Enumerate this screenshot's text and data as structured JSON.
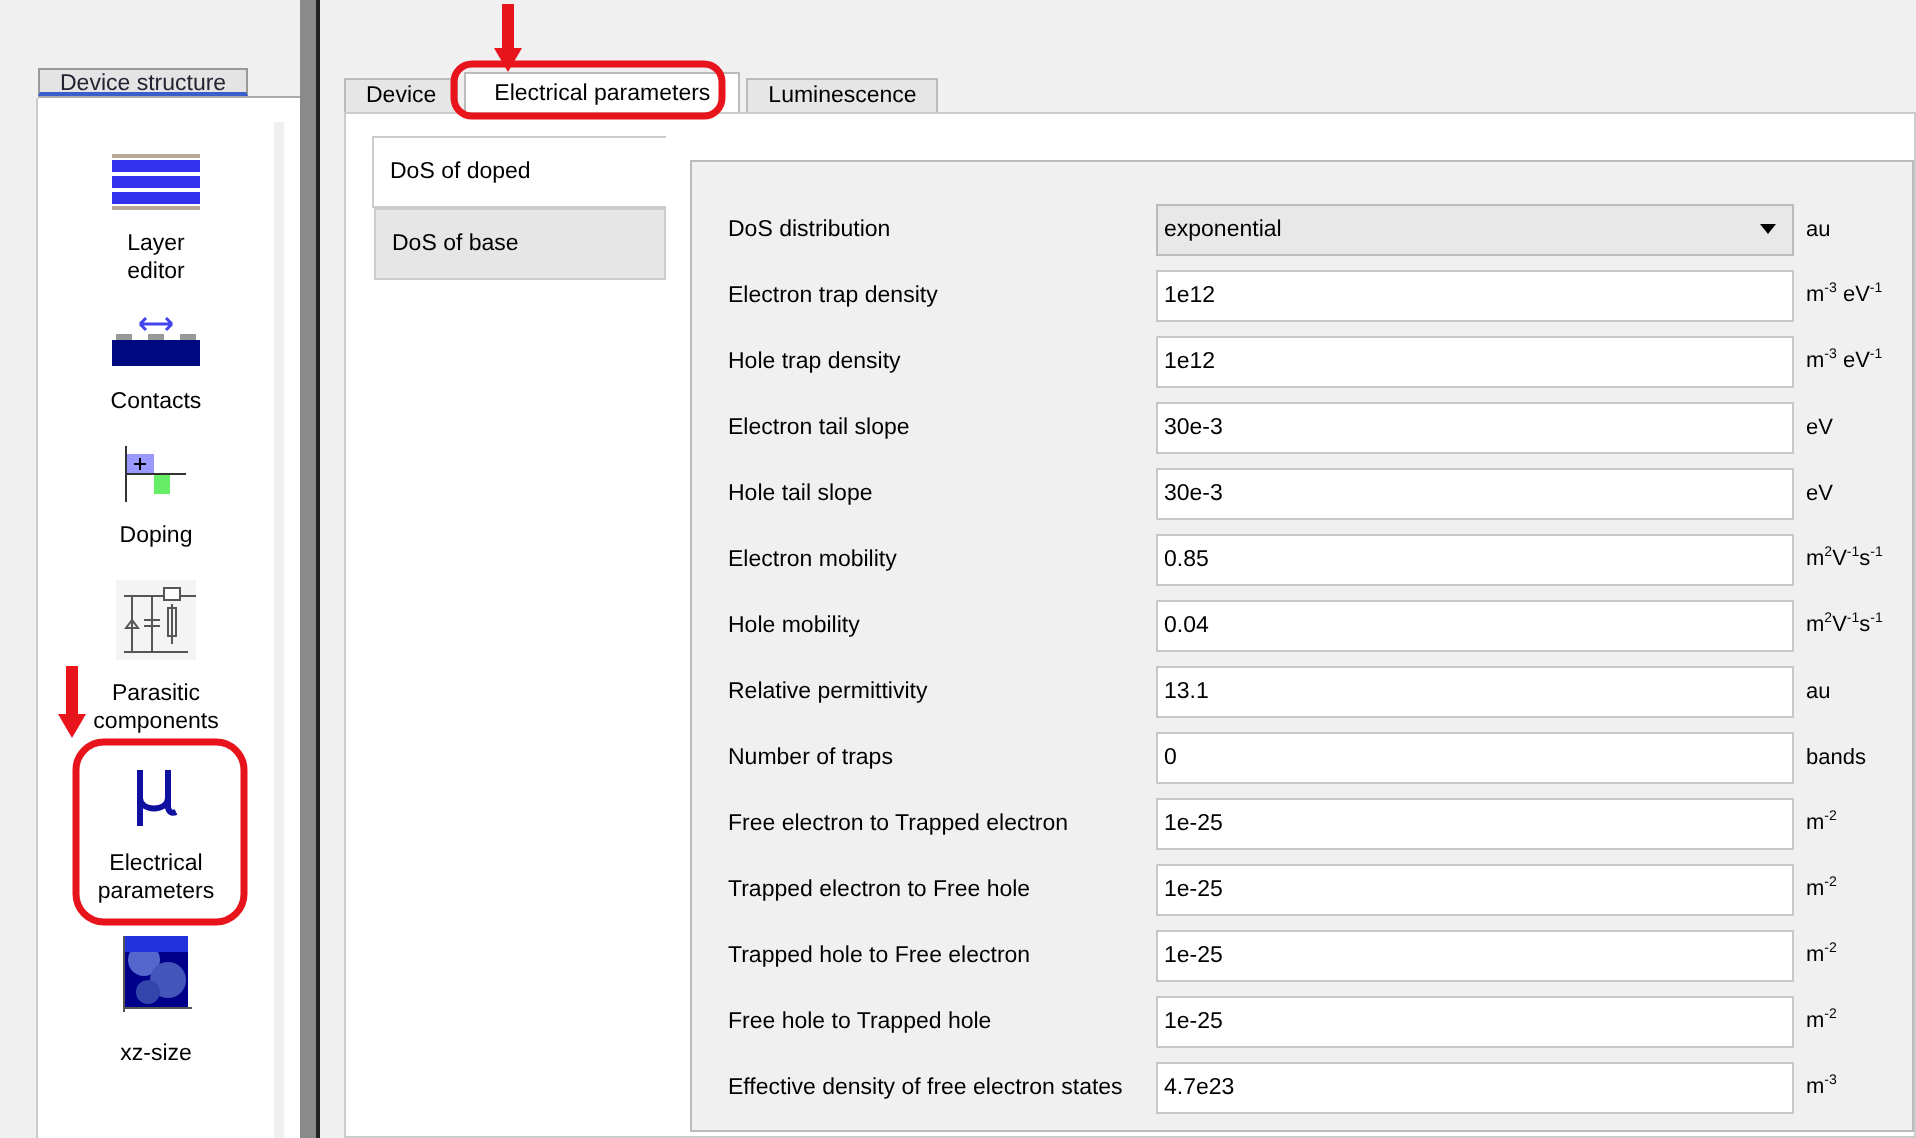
{
  "sidebar": {
    "tab": "Device structure",
    "items": [
      {
        "kind": "layers",
        "label": "Layer\neditor"
      },
      {
        "kind": "contacts",
        "label": "Contacts"
      },
      {
        "kind": "doping",
        "label": "Doping"
      },
      {
        "kind": "circuit",
        "label": "Parasitic\ncomponents"
      },
      {
        "kind": "mu",
        "label": "Electrical\nparameters"
      },
      {
        "kind": "picture",
        "label": "xz-size"
      }
    ]
  },
  "tabs": [
    {
      "label": "Device",
      "selected": false
    },
    {
      "label": "Electrical parameters",
      "selected": true
    },
    {
      "label": "Luminescence",
      "selected": false
    }
  ],
  "side_tabs": [
    {
      "label": "DoS of doped",
      "selected": true
    },
    {
      "label": "DoS of base",
      "selected": false
    }
  ],
  "rows": [
    {
      "kind": "select",
      "label": "DoS distribution",
      "value": "exponential",
      "unit": "au"
    },
    {
      "kind": "input",
      "label": "Electron trap density",
      "value": "1e12",
      "unit": "m$^{-3}$ eV$^{-1}$"
    },
    {
      "kind": "input",
      "label": "Hole trap density",
      "value": "1e12",
      "unit": "m$^{-3}$ eV$^{-1}$"
    },
    {
      "kind": "input",
      "label": "Electron tail slope",
      "value": "30e-3",
      "unit": "eV"
    },
    {
      "kind": "input",
      "label": "Hole tail slope",
      "value": "30e-3",
      "unit": "eV"
    },
    {
      "kind": "input",
      "label": "Electron mobility",
      "value": "0.85",
      "unit": "m$^{2}$V$^{-1}$s$^{-1}$"
    },
    {
      "kind": "input",
      "label": "Hole mobility",
      "value": "0.04",
      "unit": "m$^{2}$V$^{-1}$s$^{-1}$"
    },
    {
      "kind": "input",
      "label": "Relative permittivity",
      "value": "13.1",
      "unit": "au"
    },
    {
      "kind": "input",
      "label": "Number of traps",
      "value": "0",
      "unit": "bands"
    },
    {
      "kind": "input",
      "label": "Free electron to Trapped electron",
      "value": "1e-25",
      "unit": "m$^{-2}$"
    },
    {
      "kind": "input",
      "label": "Trapped electron to Free hole",
      "value": "1e-25",
      "unit": "m$^{-2}$"
    },
    {
      "kind": "input",
      "label": "Trapped hole to Free electron",
      "value": "1e-25",
      "unit": "m$^{-2}$"
    },
    {
      "kind": "input",
      "label": "Free hole to Trapped hole",
      "value": "1e-25",
      "unit": "m$^{-2}$"
    },
    {
      "kind": "input",
      "label": "Effective density of free electron states",
      "value": "4.7e23",
      "unit": "m$^{-3}$"
    }
  ]
}
